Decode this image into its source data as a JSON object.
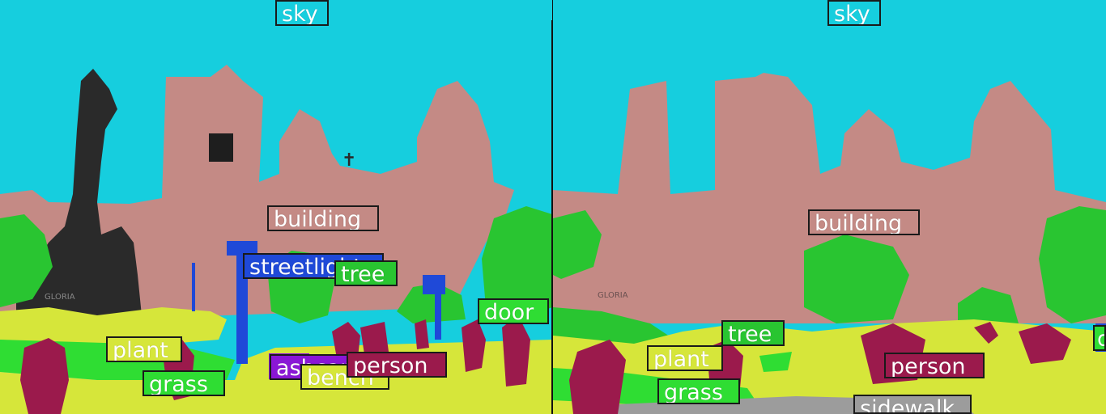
{
  "colors": {
    "sky": "#16cede",
    "building": "#c48a85",
    "tree": "#29c531",
    "grass": "#2fdd33",
    "plant": "#d6e63a",
    "person": "#9b1a4c",
    "streetlight": "#1f49d8",
    "ashcan": "#8a16d6",
    "bench": "#d6e63a",
    "door": "#2fdd33",
    "sidewalk": "#9c9c9c",
    "statue": "#2a2a2a"
  },
  "left_panel": {
    "labels": {
      "sky": "sky",
      "building": "building",
      "streetlight": "streetlight",
      "tree": "tree",
      "door": "door",
      "plant": "plant",
      "grass": "grass",
      "ashcan": "ashcan",
      "bench": "bench",
      "person": "person"
    },
    "engraving": "GLORIA"
  },
  "right_panel": {
    "labels": {
      "sky": "sky",
      "building": "building",
      "tree": "tree",
      "plant": "plant",
      "grass": "grass",
      "person": "person",
      "sidewalk": "sidewalk",
      "door": "d"
    },
    "engraving": "GLORIA"
  }
}
